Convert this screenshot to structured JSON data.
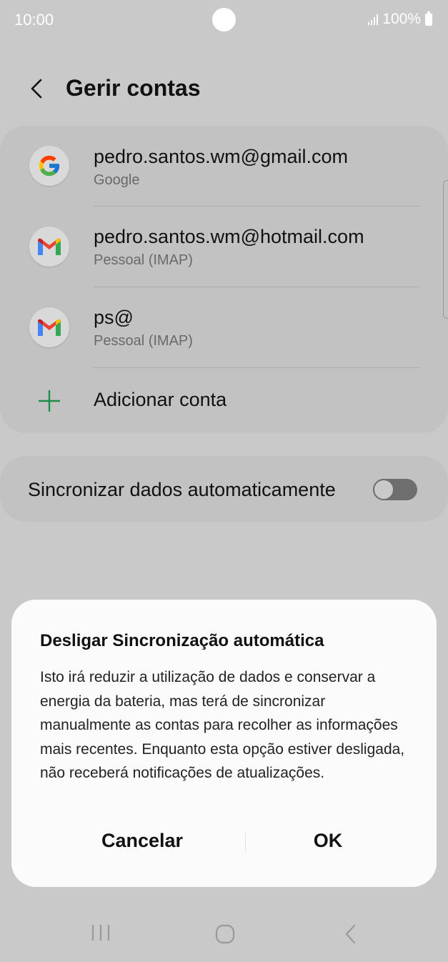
{
  "status_bar": {
    "time": "10:00",
    "battery": "100%",
    "icons": [
      "signal-icon",
      "battery-icon"
    ]
  },
  "header": {
    "title": "Gerir contas",
    "back_icon": "chevron-left-icon"
  },
  "accounts": [
    {
      "email": "pedro.santos.wm@gmail.com",
      "type": "Google",
      "icon": "google-icon"
    },
    {
      "email": "pedro.santos.wm@hotmail.com",
      "type": "Pessoal (IMAP)",
      "icon": "gmail-icon"
    },
    {
      "email": "ps@",
      "type": "Pessoal (IMAP)",
      "icon": "gmail-icon"
    }
  ],
  "add_account": {
    "label": "Adicionar conta",
    "icon": "plus-icon"
  },
  "sync": {
    "label": "Sincronizar dados automaticamente",
    "enabled": false
  },
  "dialog": {
    "title": "Desligar Sincronização automática",
    "body": "Isto irá reduzir a utilização de dados e conservar a energia da bateria, mas terá de sincronizar manualmente as contas para recolher as informações mais recentes. Enquanto esta opção estiver desligada, não receberá notificações de atualizações.",
    "cancel_label": "Cancelar",
    "ok_label": "OK"
  },
  "nav": {
    "icons": [
      "recent-apps-icon",
      "home-icon",
      "back-icon"
    ]
  },
  "colors": {
    "background_dim": "#c9c9c9",
    "card": "#c2c2c2",
    "dialog": "#fbfbfb",
    "accent_green": "#1e8e4a",
    "secondary_text": "#6a6a6a"
  }
}
